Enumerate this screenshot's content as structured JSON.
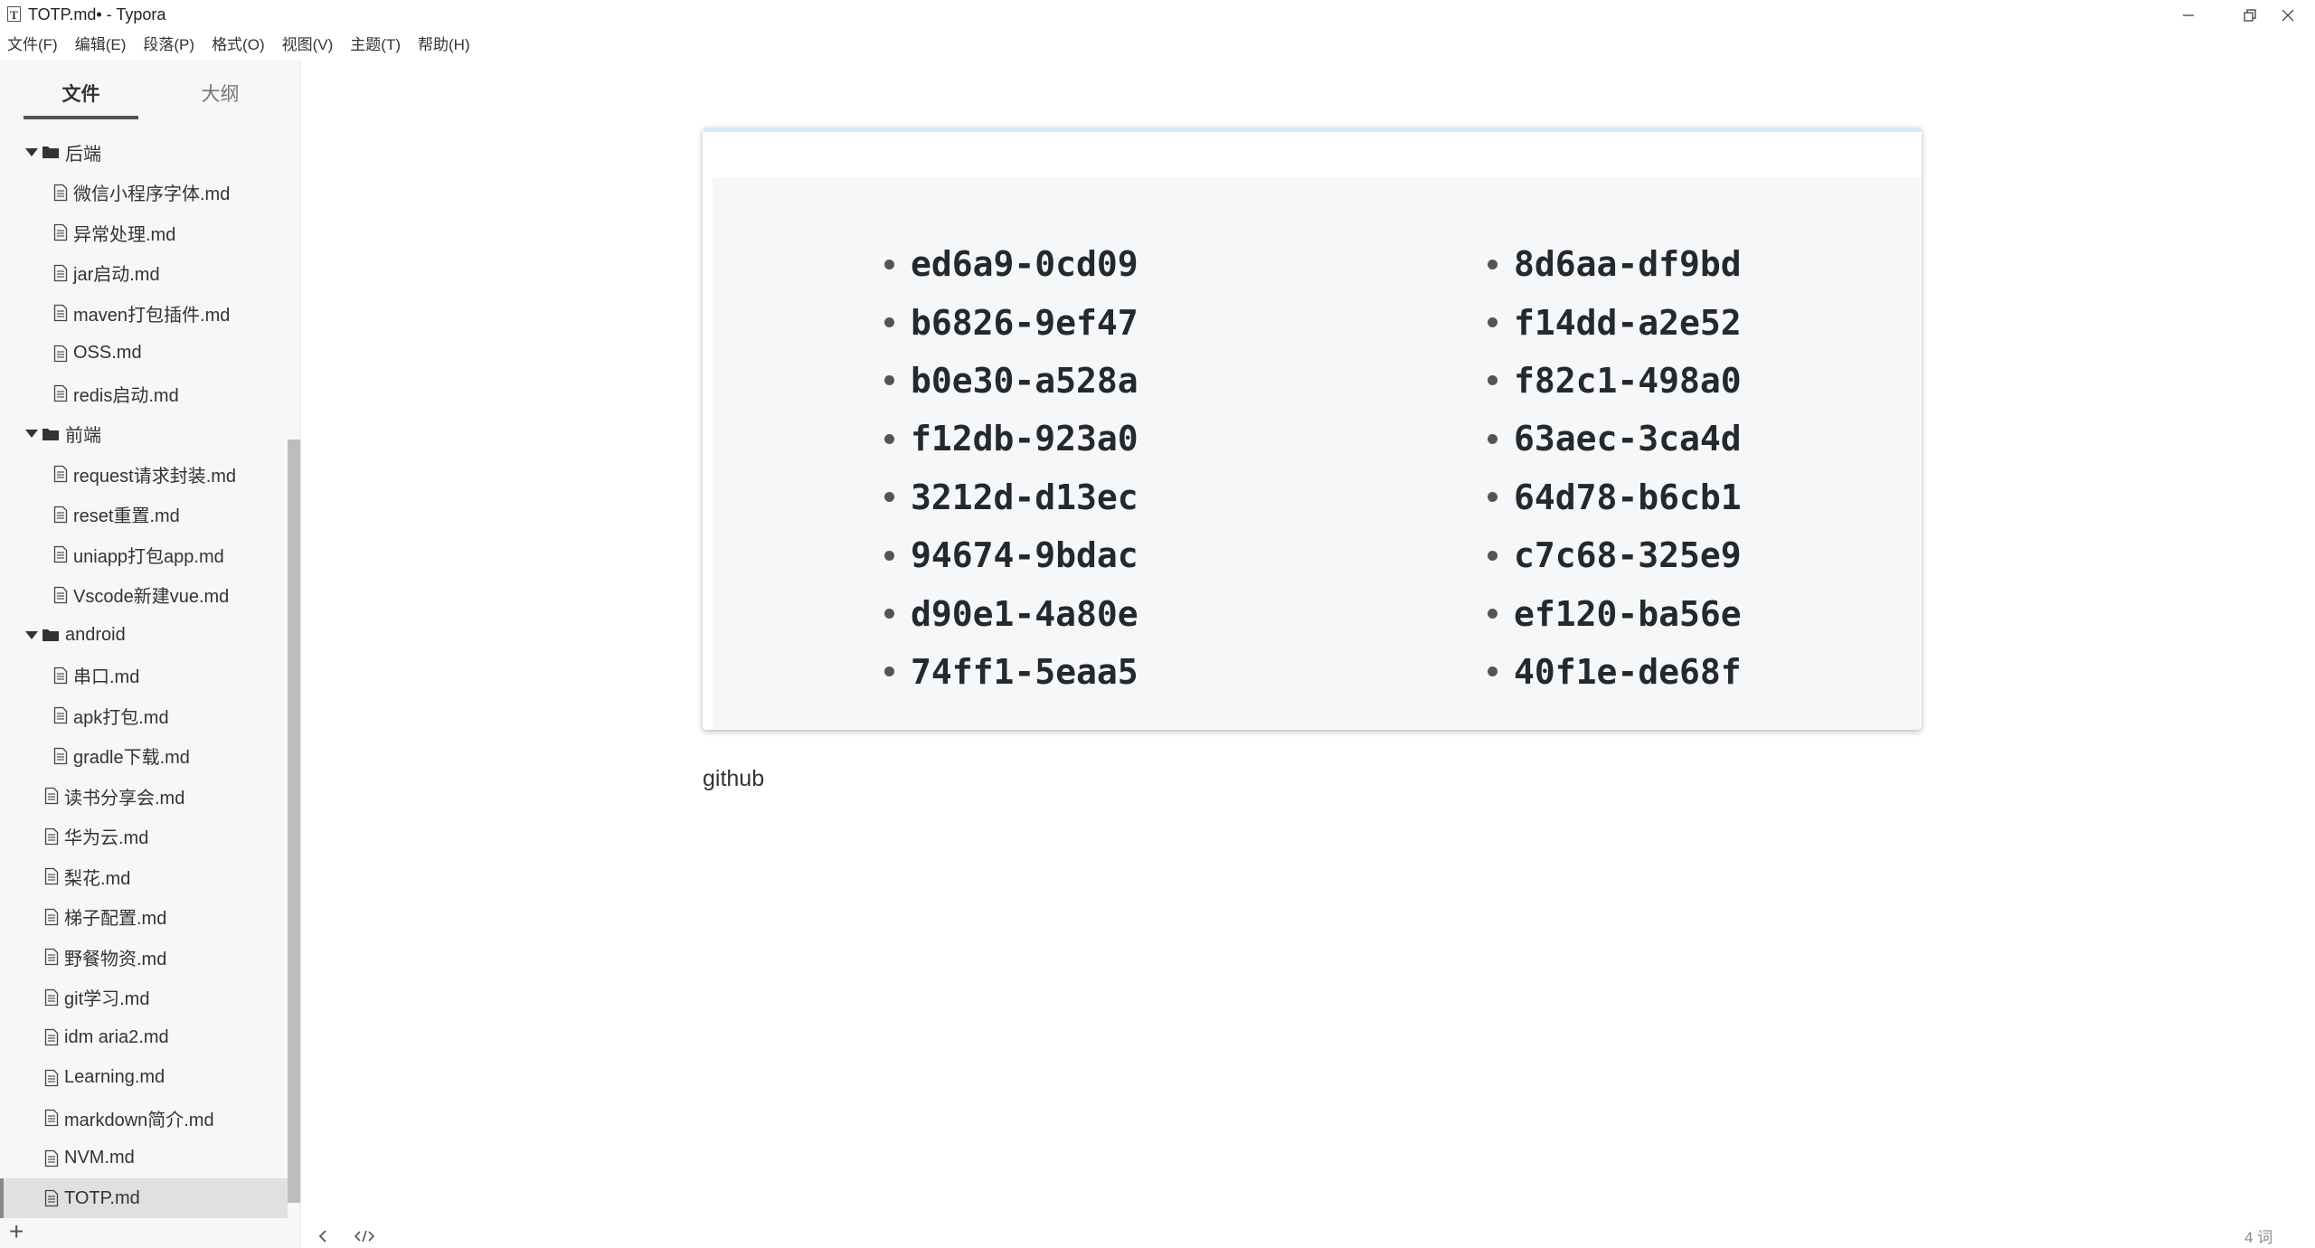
{
  "window": {
    "title": "TOTP.md• - Typora",
    "app_icon_glyph": "T",
    "controls": [
      "minimize-icon",
      "restore-icon",
      "close-icon"
    ]
  },
  "menu": [
    "文件(F)",
    "编辑(E)",
    "段落(P)",
    "格式(O)",
    "视图(V)",
    "主题(T)",
    "帮助(H)"
  ],
  "sidebar": {
    "tabs": [
      {
        "label": "文件",
        "active": true
      },
      {
        "label": "大纲",
        "active": false
      }
    ],
    "tree": [
      {
        "type": "folder",
        "label": "后端",
        "expanded": true,
        "depth": 0
      },
      {
        "type": "file",
        "label": "微信小程序字体.md",
        "depth": 1
      },
      {
        "type": "file",
        "label": "异常处理.md",
        "depth": 1
      },
      {
        "type": "file",
        "label": "jar启动.md",
        "depth": 1
      },
      {
        "type": "file",
        "label": "maven打包插件.md",
        "depth": 1
      },
      {
        "type": "file",
        "label": "OSS.md",
        "depth": 1
      },
      {
        "type": "file",
        "label": "redis启动.md",
        "depth": 1
      },
      {
        "type": "folder",
        "label": "前端",
        "expanded": true,
        "depth": 0
      },
      {
        "type": "file",
        "label": "request请求封装.md",
        "depth": 1
      },
      {
        "type": "file",
        "label": "reset重置.md",
        "depth": 1
      },
      {
        "type": "file",
        "label": "uniapp打包app.md",
        "depth": 1
      },
      {
        "type": "file",
        "label": "Vscode新建vue.md",
        "depth": 1
      },
      {
        "type": "folder",
        "label": "android",
        "expanded": true,
        "depth": 0
      },
      {
        "type": "file",
        "label": "串口.md",
        "depth": 1
      },
      {
        "type": "file",
        "label": "apk打包.md",
        "depth": 1
      },
      {
        "type": "file",
        "label": "gradle下载.md",
        "depth": 1
      },
      {
        "type": "file",
        "label": "读书分享会.md",
        "depth": 0
      },
      {
        "type": "file",
        "label": "华为云.md",
        "depth": 0
      },
      {
        "type": "file",
        "label": "梨花.md",
        "depth": 0
      },
      {
        "type": "file",
        "label": "梯子配置.md",
        "depth": 0
      },
      {
        "type": "file",
        "label": "野餐物资.md",
        "depth": 0
      },
      {
        "type": "file",
        "label": "git学习.md",
        "depth": 0
      },
      {
        "type": "file",
        "label": "idm aria2.md",
        "depth": 0
      },
      {
        "type": "file",
        "label": "Learning.md",
        "depth": 0
      },
      {
        "type": "file",
        "label": "markdown简介.md",
        "depth": 0
      },
      {
        "type": "file",
        "label": "NVM.md",
        "depth": 0
      },
      {
        "type": "file",
        "label": "TOTP.md",
        "depth": 0,
        "selected": true
      }
    ],
    "add_label": "+"
  },
  "document": {
    "image_codes_left": [
      "ed6a9-0cd09",
      "b6826-9ef47",
      "b0e30-a528a",
      "f12db-923a0",
      "3212d-d13ec",
      "94674-9bdac",
      "d90e1-4a80e",
      "74ff1-5eaa5"
    ],
    "image_codes_right": [
      "8d6aa-df9bd",
      "f14dd-a2e52",
      "f82c1-498a0",
      "63aec-3ca4d",
      "64d78-b6cb1",
      "c7c68-325e9",
      "ef120-ba56e",
      "40f1e-de68f"
    ],
    "paragraph": "github"
  },
  "status": {
    "word_count": "4 词"
  },
  "colors": {
    "sidebar_bg": "#f7f7f7",
    "selected_row": "#e0e0e0",
    "code_text": "#24292e",
    "image_panel_bg": "#f6f7f8"
  }
}
